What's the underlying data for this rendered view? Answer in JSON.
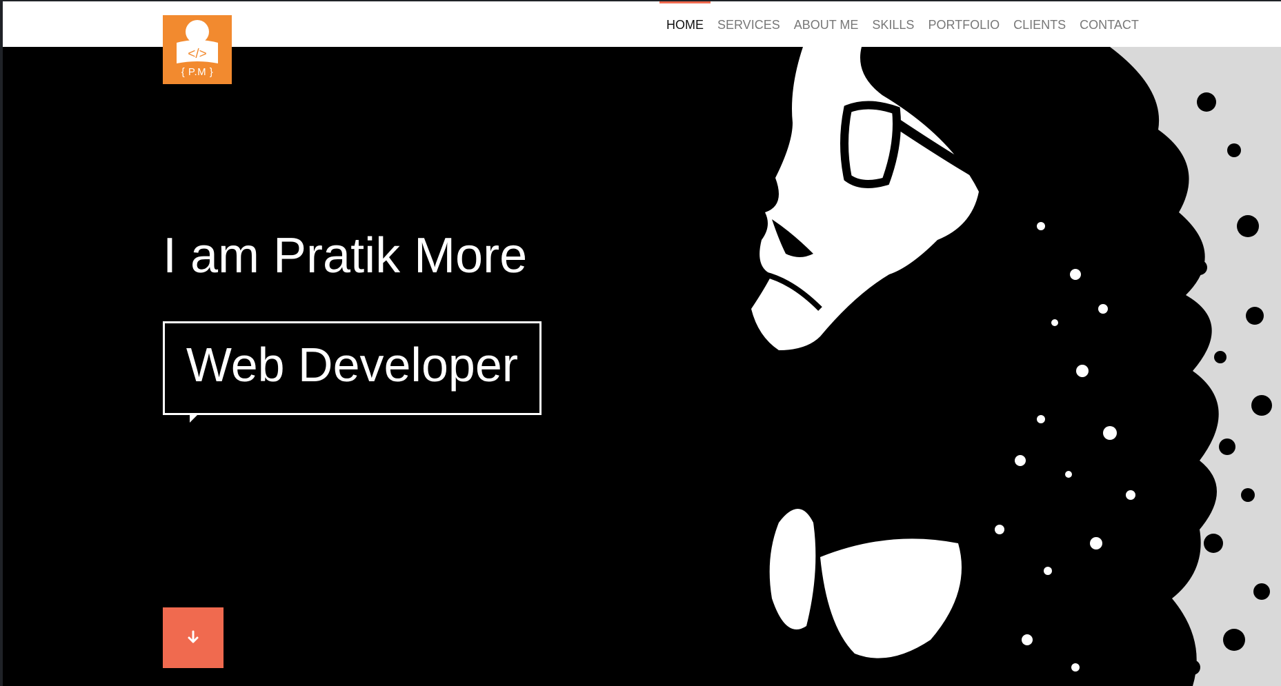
{
  "brand": {
    "logo_text": "{ P.M }",
    "logo_code": "</>",
    "logo_color": "#f28a2f"
  },
  "nav": {
    "items": [
      {
        "label": "HOME",
        "active": true
      },
      {
        "label": "SERVICES",
        "active": false
      },
      {
        "label": "ABOUT ME",
        "active": false
      },
      {
        "label": "SKILLS",
        "active": false
      },
      {
        "label": "PORTFOLIO",
        "active": false
      },
      {
        "label": "CLIENTS",
        "active": false
      },
      {
        "label": "CONTACT",
        "active": false
      }
    ],
    "active_color": "#f06a4f"
  },
  "hero": {
    "title": "I am Pratik More",
    "role": "Web Developer",
    "scroll_icon": "arrow-down-icon",
    "accent": "#f06a4f",
    "image": "portrait-illustration"
  }
}
